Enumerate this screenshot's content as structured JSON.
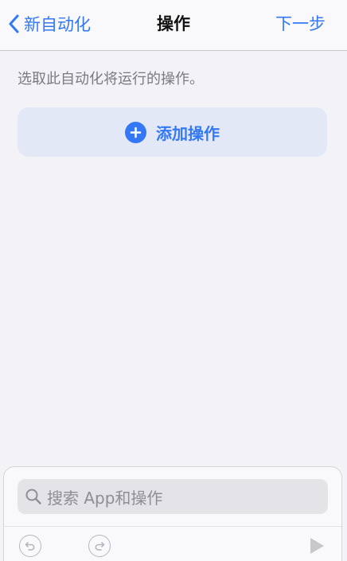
{
  "navbar": {
    "back_label": "新自动化",
    "title": "操作",
    "next_label": "下一步"
  },
  "main": {
    "hint": "选取此自动化将运行的操作。",
    "add_action_label": "添加操作"
  },
  "bottom": {
    "search_placeholder": "搜索 App和操作"
  },
  "colors": {
    "accent": "#3478f6",
    "background": "#f2f2f7",
    "add_button_bg": "#e3e8f7"
  },
  "icons": [
    "chevron-left-icon",
    "plus-icon",
    "search-icon",
    "undo-icon",
    "redo-icon",
    "play-icon"
  ]
}
